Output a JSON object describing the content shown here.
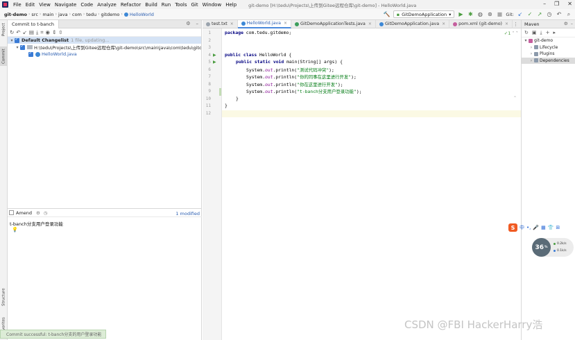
{
  "menu": {
    "items": [
      "File",
      "Edit",
      "View",
      "Navigate",
      "Code",
      "Analyze",
      "Refactor",
      "Build",
      "Run",
      "Tools",
      "Git",
      "Window",
      "Help"
    ],
    "window_title": "git-demo [H:\\tedu\\Projects\\上传到Gitee远程仓库\\git-demo] - HelloWorld.java"
  },
  "breadcrumbs": [
    "git-demo",
    "src",
    "main",
    "java",
    "com",
    "tedu",
    "gitdemo",
    "HelloWorld"
  ],
  "toolbar": {
    "run_config": "GitDemoApplication",
    "git_label": "Git:"
  },
  "left_stripe": {
    "project": "Project",
    "commit": "Commit",
    "structure": "Structure",
    "favorites": "Favorites"
  },
  "commit_panel": {
    "tab_label": "Commit to t-banch",
    "changelist_name": "Default Changelist",
    "changelist_status": "1 file, updating...",
    "folder_path": "H:\\tedu\\Projects\\上传到Gitee远程仓库\\git-demo\\src\\main\\java\\com\\tedu\\gitdemo",
    "folder_count": "1",
    "file_name": "HelloWorld.java",
    "amend_label": "Amend",
    "modified_count": "1 modified",
    "commit_message": "t-banch分支用户登录功能",
    "status_notice": "Commit successful: t-banch分支的用户登录功能"
  },
  "editor": {
    "tabs": [
      {
        "label": "test.txt",
        "active": false,
        "color": "#9aa3ad"
      },
      {
        "label": "HelloWorld.java",
        "active": true,
        "color": "#3d88d6"
      },
      {
        "label": "GitDemoApplicationTests.java",
        "active": false,
        "color": "#3d9e5c"
      },
      {
        "label": "GitDemoApplication.java",
        "active": false,
        "color": "#3d88d6"
      },
      {
        "label": "pom.xml (git-demo)",
        "active": false,
        "color": "#c55f9e"
      }
    ],
    "inspection_badge": "✓1",
    "line_numbers": [
      "1",
      "2",
      "3",
      "4",
      "5",
      "6",
      "7",
      "8",
      "9",
      "10",
      "11",
      "12"
    ],
    "code": {
      "l1_kw": "package",
      "l1_rest": " com.tedu.gitdemo;",
      "l4_kw": "public class",
      "l4_rest": " HelloWorld {",
      "l5_kw": "public static void",
      "l5_rest": " main(String[] args) {",
      "sysout_prefix": "System.",
      "sysout_field": "out",
      "sysout_call": ".println(",
      "sysout_suffix": ");",
      "str1": "\"测试代码冲突\"",
      "str2": "\"你的同事在这里进行开发\"",
      "str3": "\"你在这里进行开发\"",
      "str4": "\"t-banch分支用户登录功能\"",
      "l10": "}",
      "l11": "}"
    }
  },
  "maven": {
    "title": "Maven",
    "project": "git-demo",
    "items": [
      "Lifecycle",
      "Plugins",
      "Dependencies"
    ]
  },
  "ime": {
    "logo": "S",
    "lang": "中"
  },
  "perf": {
    "value": "36",
    "unit": "%",
    "upload": "0.2k/s",
    "download": "0.1k/s"
  },
  "watermark": "CSDN @FBI HackerHarry浩"
}
